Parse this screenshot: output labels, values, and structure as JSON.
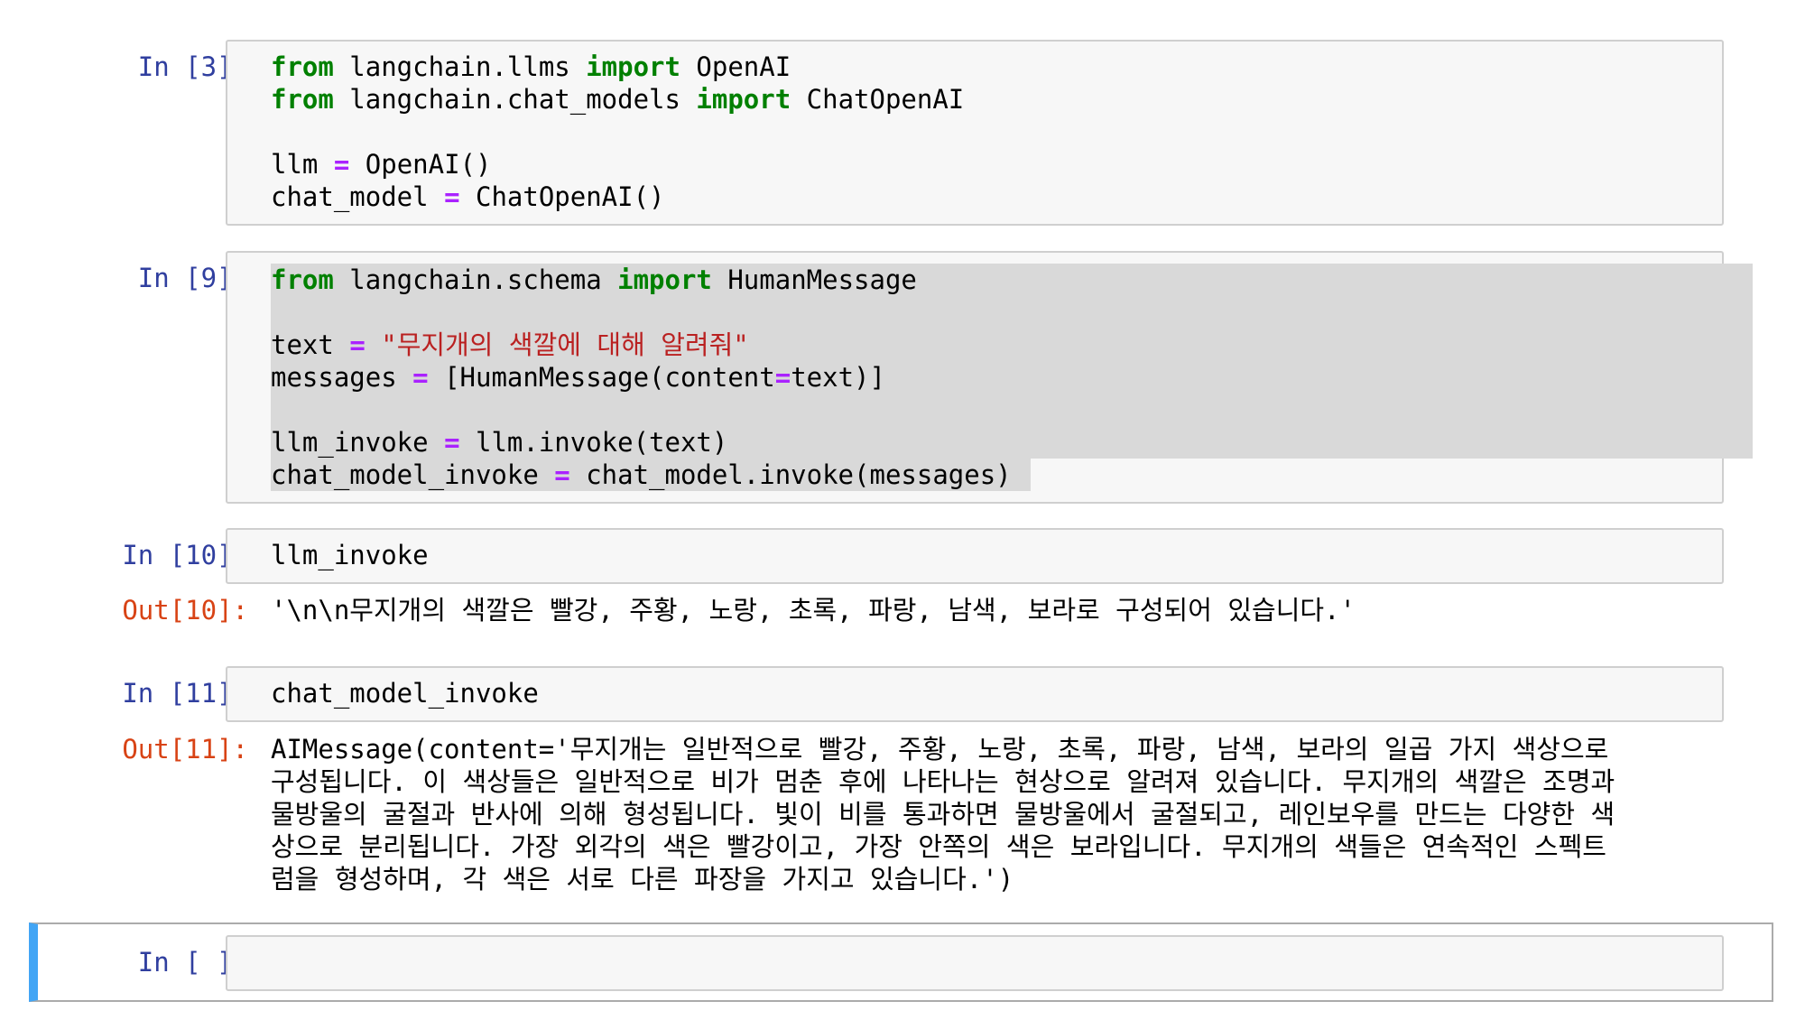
{
  "cells": [
    {
      "prompt": "In [3]:",
      "lines": [
        [
          {
            "t": "from",
            "c": "kw"
          },
          {
            "t": " langchain.llms "
          },
          {
            "t": "import",
            "c": "kw"
          },
          {
            "t": " OpenAI"
          }
        ],
        [
          {
            "t": "from",
            "c": "kw"
          },
          {
            "t": " langchain.chat_models "
          },
          {
            "t": "import",
            "c": "kw"
          },
          {
            "t": " ChatOpenAI"
          }
        ],
        [],
        [
          {
            "t": "llm "
          },
          {
            "t": "=",
            "c": "op"
          },
          {
            "t": " OpenAI()"
          }
        ],
        [
          {
            "t": "chat_model "
          },
          {
            "t": "=",
            "c": "op"
          },
          {
            "t": " ChatOpenAI()"
          }
        ]
      ]
    },
    {
      "prompt": "In [9]:",
      "lines": [
        [
          {
            "t": "from",
            "c": "kw"
          },
          {
            "t": " langchain.schema "
          },
          {
            "t": "import",
            "c": "kw"
          },
          {
            "t": " HumanMessage"
          }
        ],
        [],
        [
          {
            "t": "text "
          },
          {
            "t": "=",
            "c": "op"
          },
          {
            "t": " "
          },
          {
            "t": "\"무지개의 색깔에 대해 알려줘\"",
            "c": "str"
          }
        ],
        [
          {
            "t": "messages "
          },
          {
            "t": "=",
            "c": "op"
          },
          {
            "t": " [HumanMessage(content"
          },
          {
            "t": "=",
            "c": "op"
          },
          {
            "t": "text)]"
          }
        ],
        [],
        [
          {
            "t": "llm_invoke "
          },
          {
            "t": "=",
            "c": "op"
          },
          {
            "t": " llm.invoke(text)"
          }
        ],
        [
          {
            "t": "chat_model_invoke "
          },
          {
            "t": "=",
            "c": "op"
          },
          {
            "t": " chat_model.invoke(messages)"
          }
        ]
      ]
    },
    {
      "prompt": "In [10]:",
      "lines": [
        [
          {
            "t": "llm_invoke"
          }
        ]
      ],
      "out_prompt": "Out[10]:",
      "output": "'\\n\\n무지개의 색깔은 빨강, 주황, 노랑, 초록, 파랑, 남색, 보라로 구성되어 있습니다.'"
    },
    {
      "prompt": "In [11]:",
      "lines": [
        [
          {
            "t": "chat_model_invoke"
          }
        ]
      ],
      "out_prompt": "Out[11]:",
      "output": "AIMessage(content='무지개는 일반적으로 빨강, 주황, 노랑, 초록, 파랑, 남색, 보라의 일곱 가지 색상으로\n구성됩니다. 이 색상들은 일반적으로 비가 멈춘 후에 나타나는 현상으로 알려져 있습니다. 무지개의 색깔은 조명과\n물방울의 굴절과 반사에 의해 형성됩니다. 빛이 비를 통과하면 물방울에서 굴절되고, 레인보우를 만드는 다양한 색\n상으로 분리됩니다. 가장 외각의 색은 빨강이고, 가장 안쪽의 색은 보라입니다. 무지개의 색들은 연속적인 스펙트\n럼을 형성하며, 각 색은 서로 다른 파장을 가지고 있습니다.')"
    },
    {
      "prompt": "In [ ]:",
      "lines": []
    }
  ]
}
